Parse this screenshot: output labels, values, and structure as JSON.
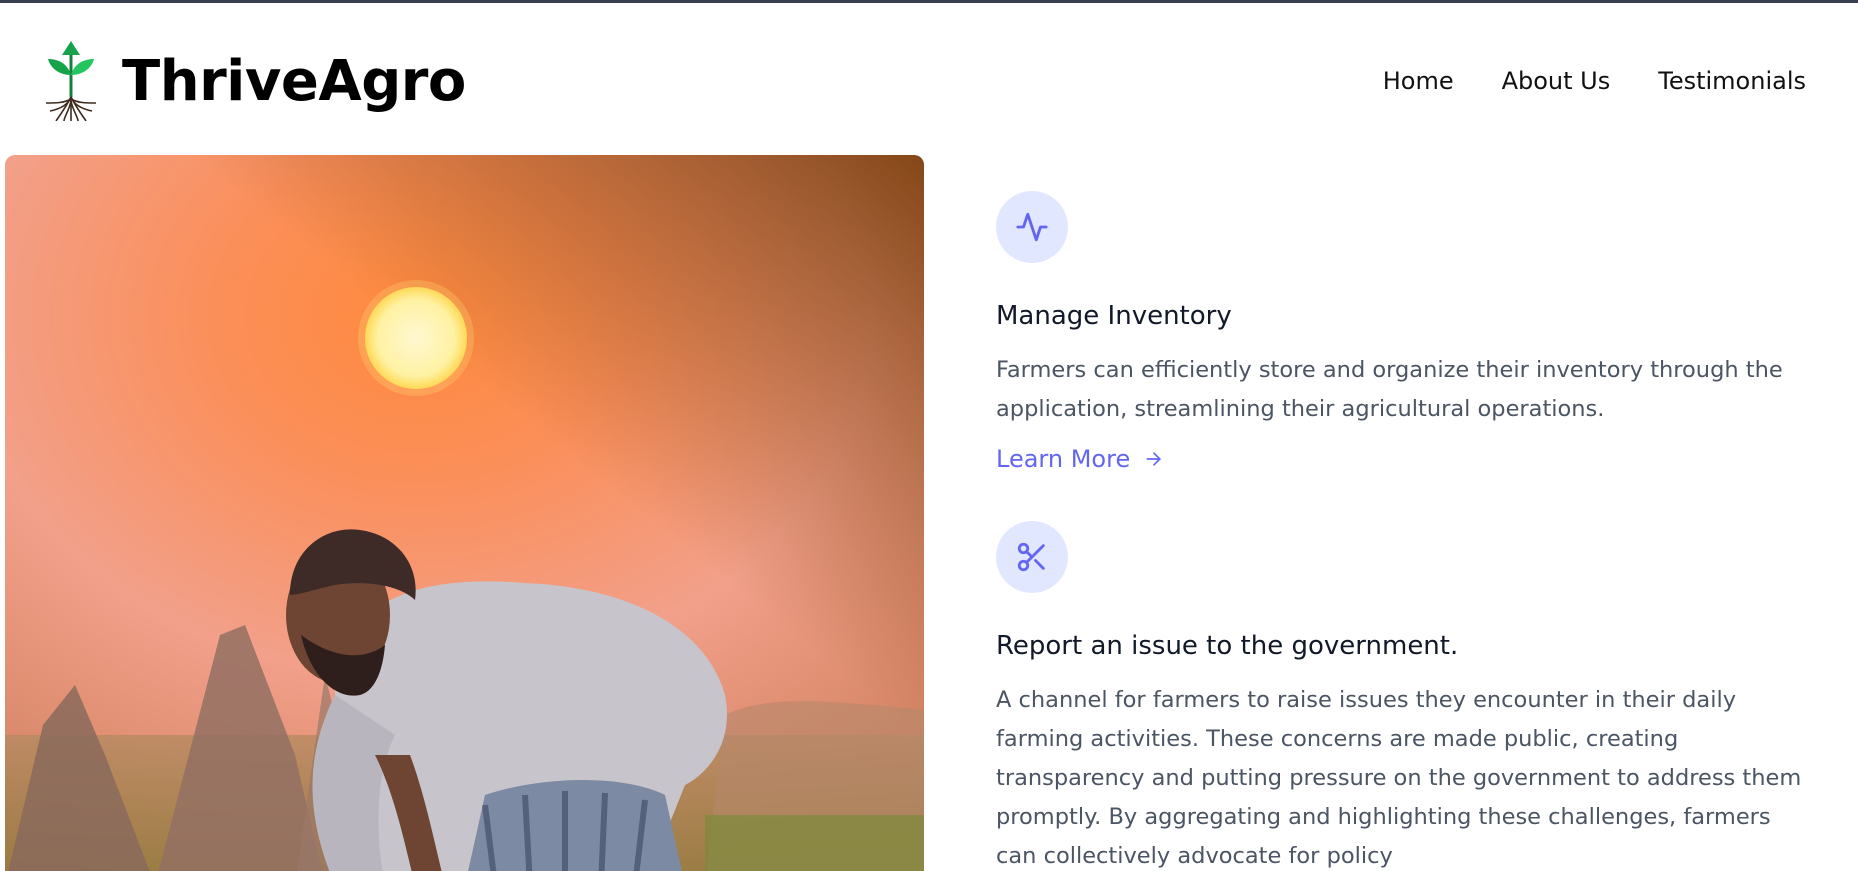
{
  "brand": {
    "name": "ThriveAgro"
  },
  "nav": {
    "items": [
      "Home",
      "About Us",
      "Testimonials"
    ]
  },
  "hero": {
    "alt": "Farmer working in a field at sunset"
  },
  "features": [
    {
      "icon": "activity-icon",
      "title": "Manage Inventory",
      "description": "Farmers can efficiently store and organize their inventory through the application, streamlining their agricultural operations.",
      "link": "Learn More"
    },
    {
      "icon": "scissors-icon",
      "title": "Report an issue to the government.",
      "description": "A channel for farmers to raise issues they encounter in their daily farming activities. These concerns are made public, creating transparency and putting pressure on the government to address them promptly. By aggregating and highlighting these challenges, farmers can collectively advocate for policy"
    }
  ],
  "colors": {
    "accent": "#6366f1",
    "icon_bg": "#e0e7ff",
    "logo_green": "#16a34a"
  }
}
